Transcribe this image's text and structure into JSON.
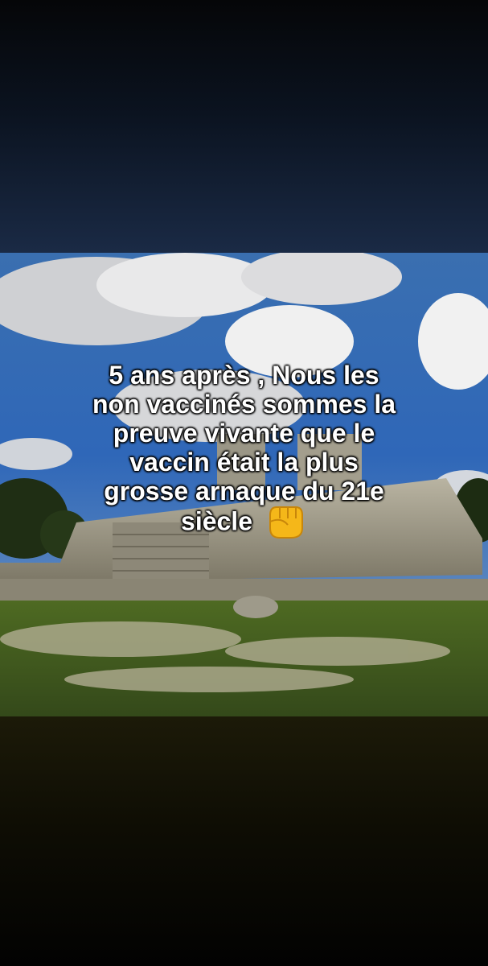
{
  "caption": {
    "lines": [
      "5 ans après , Nous les",
      "non vaccinés sommes la",
      "preuve vivante que le",
      "vaccin était la plus",
      "grosse arnaque du 21e",
      "siècle"
    ],
    "emoji": "fist-icon"
  },
  "colors": {
    "sky": "#2b6fc0",
    "grass": "#3d5a1e",
    "text": "#ffffff"
  }
}
